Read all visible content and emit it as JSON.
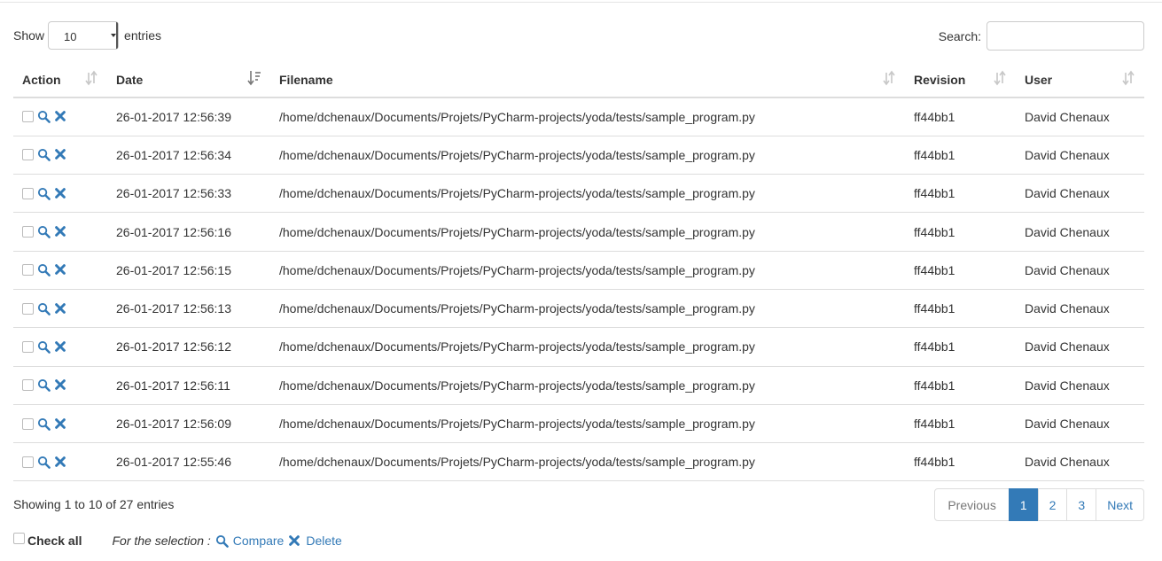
{
  "length_menu": {
    "show_label": "Show",
    "value": "10",
    "entries_label": "entries"
  },
  "search": {
    "label": "Search:",
    "value": ""
  },
  "columns": [
    {
      "label": "Action",
      "sort": "none"
    },
    {
      "label": "Date",
      "sort": "desc"
    },
    {
      "label": "Filename",
      "sort": "none"
    },
    {
      "label": "Revision",
      "sort": "none"
    },
    {
      "label": "User",
      "sort": "none"
    }
  ],
  "rows": [
    {
      "date": "26-01-2017 12:56:39",
      "filename": "/home/dchenaux/Documents/Projets/PyCharm-projects/yoda/tests/sample_program.py",
      "revision": "ff44bb1",
      "user": "David Chenaux"
    },
    {
      "date": "26-01-2017 12:56:34",
      "filename": "/home/dchenaux/Documents/Projets/PyCharm-projects/yoda/tests/sample_program.py",
      "revision": "ff44bb1",
      "user": "David Chenaux"
    },
    {
      "date": "26-01-2017 12:56:33",
      "filename": "/home/dchenaux/Documents/Projets/PyCharm-projects/yoda/tests/sample_program.py",
      "revision": "ff44bb1",
      "user": "David Chenaux"
    },
    {
      "date": "26-01-2017 12:56:16",
      "filename": "/home/dchenaux/Documents/Projets/PyCharm-projects/yoda/tests/sample_program.py",
      "revision": "ff44bb1",
      "user": "David Chenaux"
    },
    {
      "date": "26-01-2017 12:56:15",
      "filename": "/home/dchenaux/Documents/Projets/PyCharm-projects/yoda/tests/sample_program.py",
      "revision": "ff44bb1",
      "user": "David Chenaux"
    },
    {
      "date": "26-01-2017 12:56:13",
      "filename": "/home/dchenaux/Documents/Projets/PyCharm-projects/yoda/tests/sample_program.py",
      "revision": "ff44bb1",
      "user": "David Chenaux"
    },
    {
      "date": "26-01-2017 12:56:12",
      "filename": "/home/dchenaux/Documents/Projets/PyCharm-projects/yoda/tests/sample_program.py",
      "revision": "ff44bb1",
      "user": "David Chenaux"
    },
    {
      "date": "26-01-2017 12:56:11",
      "filename": "/home/dchenaux/Documents/Projets/PyCharm-projects/yoda/tests/sample_program.py",
      "revision": "ff44bb1",
      "user": "David Chenaux"
    },
    {
      "date": "26-01-2017 12:56:09",
      "filename": "/home/dchenaux/Documents/Projets/PyCharm-projects/yoda/tests/sample_program.py",
      "revision": "ff44bb1",
      "user": "David Chenaux"
    },
    {
      "date": "26-01-2017 12:55:46",
      "filename": "/home/dchenaux/Documents/Projets/PyCharm-projects/yoda/tests/sample_program.py",
      "revision": "ff44bb1",
      "user": "David Chenaux"
    }
  ],
  "row_actions": {
    "checkbox": false,
    "view_icon": "search-icon",
    "delete_icon": "close-icon"
  },
  "info": "Showing 1 to 10 of 27 entries",
  "pagination": {
    "previous": "Previous",
    "pages": [
      "1",
      "2",
      "3"
    ],
    "current": "1",
    "next": "Next"
  },
  "bulk": {
    "check_all": "Check all",
    "for_selection": "For the selection :",
    "compare": "Compare",
    "delete": "Delete"
  },
  "colors": {
    "link": "#337ab7",
    "border": "#dddddd",
    "text": "#333333",
    "muted": "#777777"
  }
}
